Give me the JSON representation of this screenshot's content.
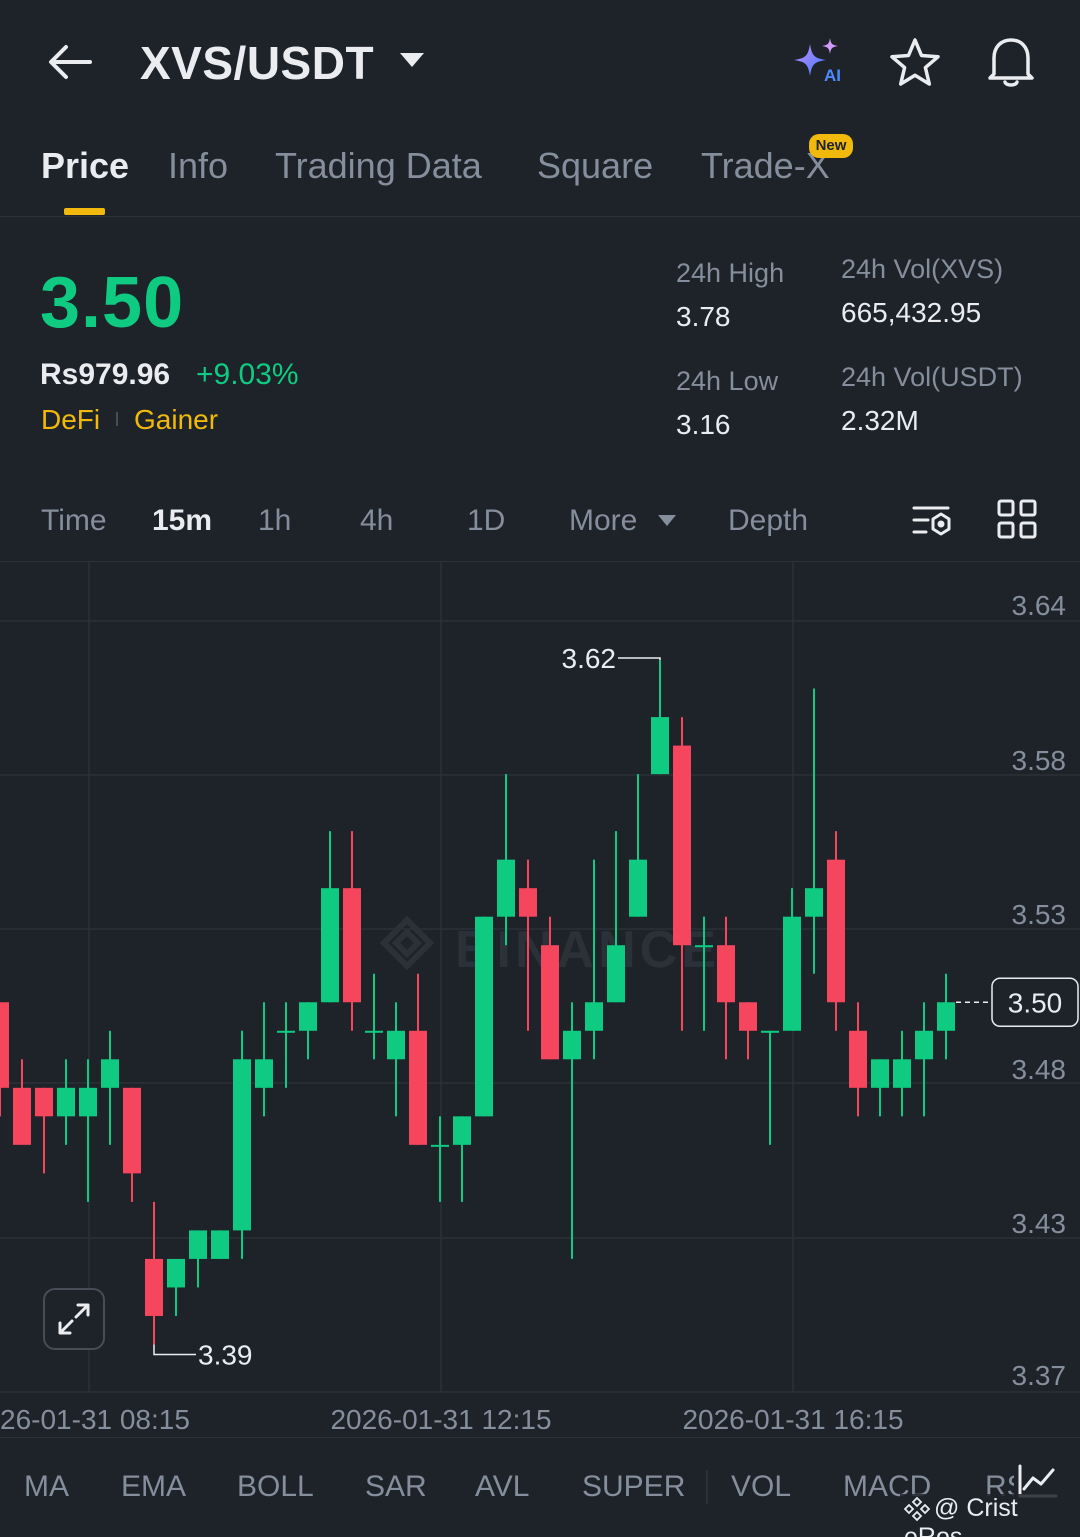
{
  "header": {
    "pair": "XVS/USDT",
    "icons": {
      "back": "back-arrow-icon",
      "ai": "ai-sparkle-icon",
      "favorite": "star-icon",
      "alert": "bell-icon"
    }
  },
  "tabs": [
    {
      "label": "Price",
      "active": true
    },
    {
      "label": "Info"
    },
    {
      "label": "Trading Data"
    },
    {
      "label": "Square"
    },
    {
      "label": "Trade-X",
      "badge": "New"
    }
  ],
  "ticker": {
    "last_price": "3.50",
    "fiat_price": "Rs979.96",
    "change_pct": "+9.03%",
    "tags": [
      "DeFi",
      "Gainer"
    ],
    "high_label": "24h High",
    "high": "3.78",
    "low_label": "24h Low",
    "low": "3.16",
    "vol_base_label": "24h Vol(XVS)",
    "vol_base": "665,432.95",
    "vol_quote_label": "24h Vol(USDT)",
    "vol_quote": "2.32M"
  },
  "timeframes": {
    "items": [
      "Time",
      "15m",
      "1h",
      "4h",
      "1D",
      "More",
      "Depth"
    ],
    "active": "15m"
  },
  "colors": {
    "up": "#0ecb81",
    "down": "#f6465d",
    "accent": "#f0b90b",
    "bg": "#1e2329",
    "muted": "#848e9c",
    "grid": "#2b3139"
  },
  "chart_data": {
    "type": "candlestick",
    "interval": "15m",
    "price_axis": {
      "ticks": [
        "3.64",
        "3.58",
        "3.53",
        "3.48",
        "3.43",
        "3.37"
      ],
      "range": [
        3.37,
        3.64
      ]
    },
    "time_axis": {
      "ticks": [
        "26-01-31 08:15",
        "2026-01-31 12:15",
        "2026-01-31 16:15"
      ]
    },
    "high_marker": "3.62",
    "low_marker": "3.39",
    "current_price_label": "3.50",
    "watermark": "BINANCE",
    "candles": [
      [
        3.5,
        3.5,
        3.47,
        3.46
      ],
      [
        3.47,
        3.48,
        3.45,
        3.46
      ],
      [
        3.47,
        3.47,
        3.46,
        3.44
      ],
      [
        3.46,
        3.48,
        3.47,
        3.45
      ],
      [
        3.46,
        3.48,
        3.47,
        3.43
      ],
      [
        3.47,
        3.49,
        3.48,
        3.45
      ],
      [
        3.47,
        3.47,
        3.44,
        3.43
      ],
      [
        3.41,
        3.43,
        3.39,
        3.38
      ],
      [
        3.4,
        3.41,
        3.41,
        3.39
      ],
      [
        3.41,
        3.42,
        3.42,
        3.4
      ],
      [
        3.41,
        3.42,
        3.42,
        3.41
      ],
      [
        3.42,
        3.49,
        3.48,
        3.41
      ],
      [
        3.47,
        3.5,
        3.48,
        3.46
      ],
      [
        3.49,
        3.5,
        3.49,
        3.47
      ],
      [
        3.49,
        3.5,
        3.5,
        3.48
      ],
      [
        3.5,
        3.56,
        3.54,
        3.5
      ],
      [
        3.54,
        3.56,
        3.5,
        3.49
      ],
      [
        3.49,
        3.51,
        3.49,
        3.48
      ],
      [
        3.48,
        3.5,
        3.49,
        3.46
      ],
      [
        3.49,
        3.51,
        3.45,
        3.45
      ],
      [
        3.45,
        3.46,
        3.45,
        3.43
      ],
      [
        3.45,
        3.46,
        3.46,
        3.43
      ],
      [
        3.46,
        3.53,
        3.53,
        3.46
      ],
      [
        3.53,
        3.58,
        3.55,
        3.52
      ],
      [
        3.54,
        3.55,
        3.53,
        3.49
      ],
      [
        3.52,
        3.53,
        3.48,
        3.48
      ],
      [
        3.48,
        3.5,
        3.49,
        3.41
      ],
      [
        3.49,
        3.55,
        3.5,
        3.48
      ],
      [
        3.5,
        3.56,
        3.52,
        3.5
      ],
      [
        3.53,
        3.58,
        3.55,
        3.53
      ],
      [
        3.58,
        3.62,
        3.6,
        3.58
      ],
      [
        3.59,
        3.6,
        3.52,
        3.49
      ],
      [
        3.52,
        3.53,
        3.52,
        3.49
      ],
      [
        3.52,
        3.53,
        3.5,
        3.48
      ],
      [
        3.5,
        3.5,
        3.49,
        3.48
      ],
      [
        3.49,
        3.49,
        3.49,
        3.45
      ],
      [
        3.49,
        3.54,
        3.53,
        3.49
      ],
      [
        3.53,
        3.61,
        3.54,
        3.51
      ],
      [
        3.55,
        3.56,
        3.5,
        3.49
      ],
      [
        3.49,
        3.5,
        3.47,
        3.46
      ],
      [
        3.47,
        3.48,
        3.48,
        3.46
      ],
      [
        3.47,
        3.49,
        3.48,
        3.46
      ],
      [
        3.48,
        3.5,
        3.49,
        3.46
      ],
      [
        3.49,
        3.51,
        3.5,
        3.48
      ]
    ]
  },
  "indicators": [
    "MA",
    "EMA",
    "BOLL",
    "SAR",
    "AVL",
    "SUPER",
    "VOL",
    "MACD",
    "RS"
  ],
  "watermark_credit": "@ Crist eRos"
}
